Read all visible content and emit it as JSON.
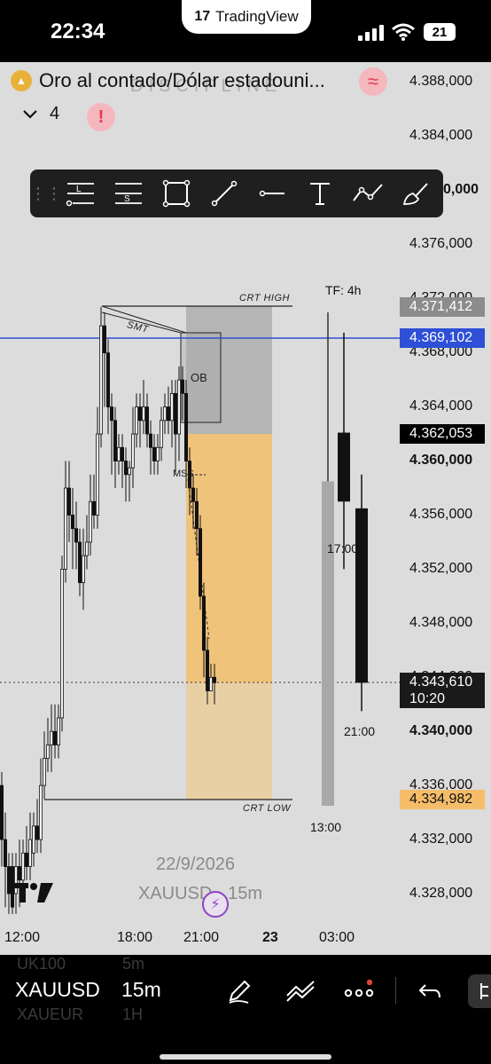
{
  "status_bar": {
    "time": "22:34",
    "app_pill": "TradingView",
    "battery": "21",
    "icons": [
      "cellular-signal-icon",
      "wifi-icon",
      "battery-icon"
    ]
  },
  "header": {
    "symbol_title": "Oro al contado/Dólar estadouni...",
    "watermark_text": "DISCIPLINE",
    "indicator_count": "4"
  },
  "drawing_toolbar": {
    "tools": [
      "long-position-tool",
      "short-position-tool",
      "rectangle-tool",
      "trend-line-tool",
      "horizontal-ray-tool",
      "text-tool",
      "path-tool",
      "brush-tool"
    ],
    "long_letter": "L",
    "short_letter": "S"
  },
  "price_axis": {
    "labels": [
      "4.388,000",
      "4.384,000",
      "4.380,000",
      "4.376,000",
      "4.372,000",
      "4.368,000",
      "4.364,000",
      "4.360,000",
      "4.356,000",
      "4.352,000",
      "4.348,000",
      "4.344,000",
      "4.340,000",
      "4.336,000",
      "4.332,000",
      "4.328,000"
    ],
    "partial_label": "0,000",
    "tags": {
      "crt_high": "4.371,412",
      "blue_line": "4.369,102",
      "black_level": "4.362,053",
      "current_price": "4.343,610",
      "countdown": "10:20",
      "crt_low": "4.334,982"
    },
    "colors": {
      "crt_high": "#8c8c8c",
      "blue_line": "#2e4fd6",
      "black_level": "#000000",
      "current": "#1a1a1a",
      "crt_low": "#f5bd6a"
    }
  },
  "time_axis": {
    "labels": [
      "12:00",
      "18:00",
      "21:00",
      "23",
      "03:00"
    ]
  },
  "chart_annotations": {
    "crt_high": "CRT HIGH",
    "crt_low": "CRT LOW",
    "smt": "SMT",
    "ob": "OB",
    "mss": "MSS",
    "tf": "TF: 4h",
    "hour_17": "17:00",
    "hour_21": "21:00",
    "hour_13": "13:00"
  },
  "watermarks": {
    "date": "22/9/2026",
    "symbol": "XAUUSD · 15m"
  },
  "bottom_bar": {
    "symbol": "XAUUSD",
    "timeframe": "15m",
    "ghost_above_symbol": "UK100",
    "ghost_above_tf": "5m",
    "ghost_below_symbol": "XAUEUR",
    "ghost_below_tf": "1H",
    "icons": [
      "draw-pencil-icon",
      "indicators-icon",
      "more-dots-icon",
      "undo-icon",
      "side-panel-icon"
    ],
    "notification_color": "#e0453a"
  },
  "chart_data": {
    "type": "candlestick",
    "timeframe": "15m",
    "htf_timeframe": "4h",
    "y_range": [
      4326,
      4390
    ],
    "levels": {
      "crt_high": 4371.412,
      "horizontal_line": 4369.102,
      "black_level": 4362.053,
      "last_price": 4343.61,
      "crt_low": 4334.982
    },
    "htf_candles": [
      {
        "label": "13:00",
        "open": 4334.5,
        "high": 4371.0,
        "low": 4335.0,
        "close": 4358.5,
        "color": "gray"
      },
      {
        "label": "17:00",
        "open": 4357.0,
        "high": 4369.5,
        "low": 4352.0,
        "close": 4362.1,
        "color": "black"
      },
      {
        "label": "21:00",
        "open": 4356.5,
        "high": 4359.0,
        "low": 4341.5,
        "close": 4343.6,
        "color": "black"
      }
    ]
  }
}
